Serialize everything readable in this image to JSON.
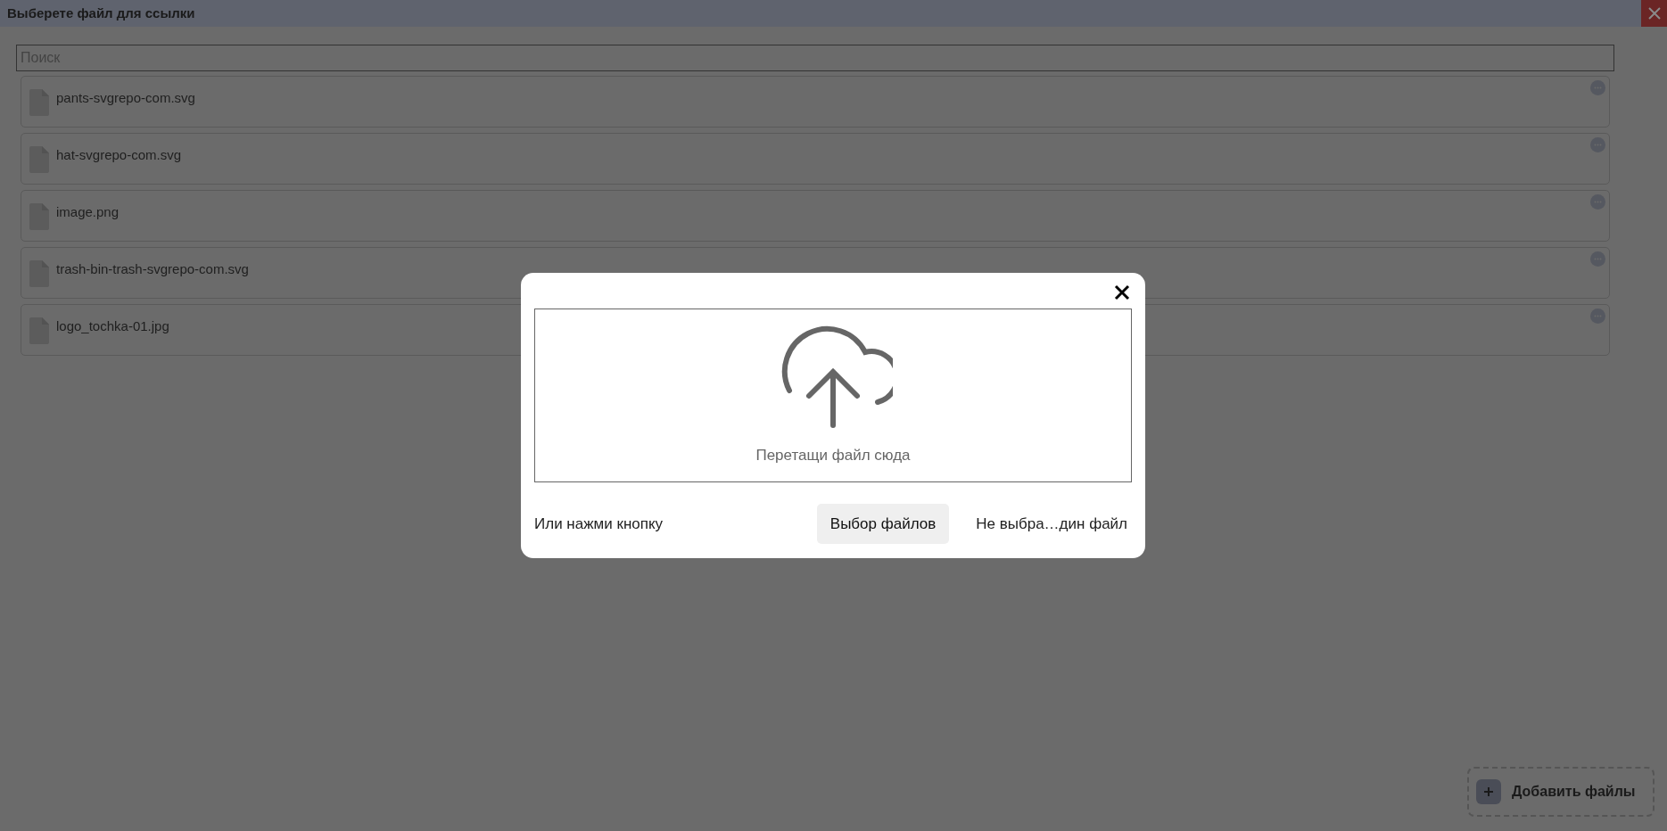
{
  "window": {
    "title": "Выберете файл для ссылки"
  },
  "search": {
    "placeholder": "Поиск"
  },
  "files": [
    {
      "name": "pants-svgrepo-com.svg"
    },
    {
      "name": "hat-svgrepo-com.svg"
    },
    {
      "name": "image.png"
    },
    {
      "name": "trash-bin-trash-svgrepo-com.svg"
    },
    {
      "name": "logo_tochka-01.jpg"
    }
  ],
  "add_button": {
    "label": "Добавить файлы"
  },
  "upload_dialog": {
    "drop_text": "Перетащи файл сюда",
    "hint": "Или нажми кнопку",
    "choose_button": "Выбор файлов",
    "file_status": "Не выбра…дин файл"
  }
}
